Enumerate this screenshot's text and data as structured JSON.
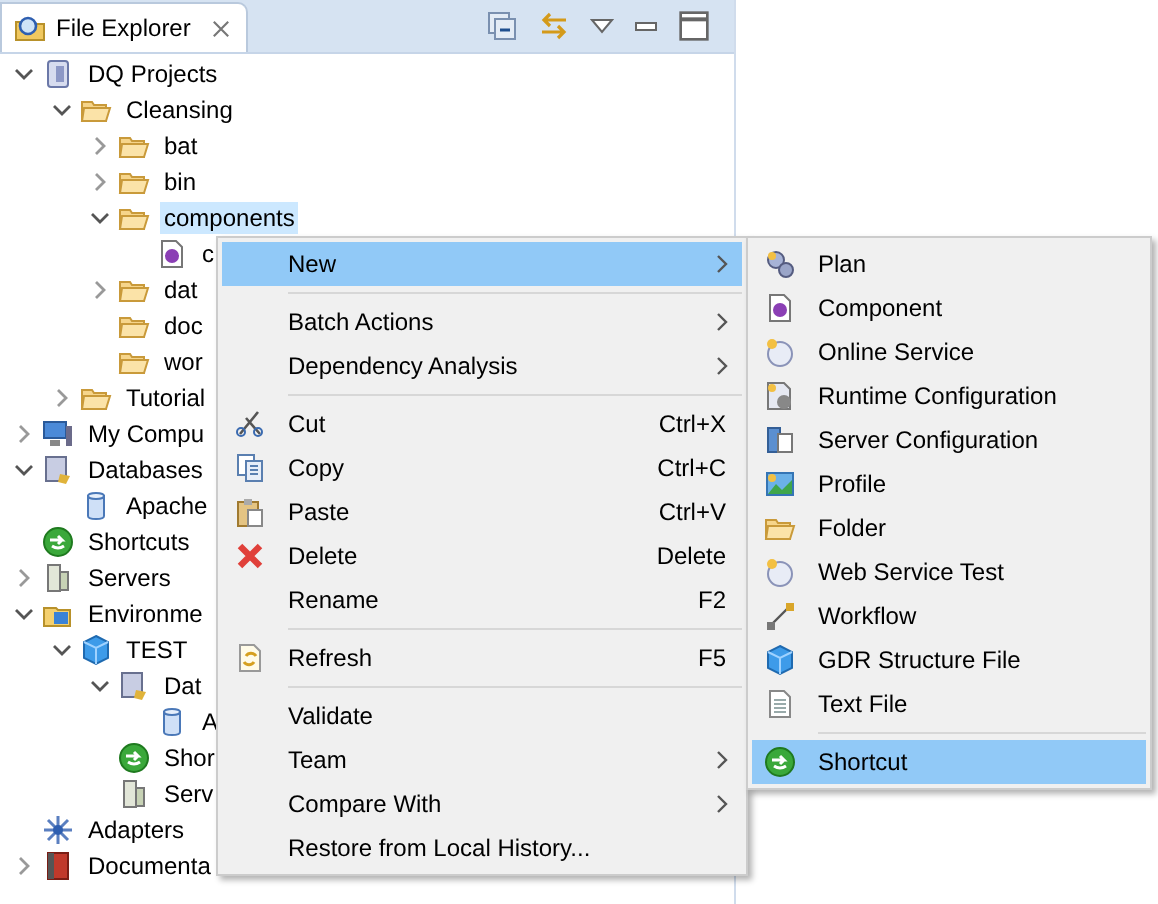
{
  "view": {
    "tab": {
      "title": "File Explorer",
      "selected": true
    }
  },
  "tree": [
    {
      "label": "DQ Projects",
      "kind": "project",
      "expanded": true,
      "selected": false,
      "children": [
        {
          "label": "Cleansing",
          "kind": "folder",
          "expanded": true,
          "selected": false,
          "children": [
            {
              "label": "bat",
              "kind": "folder",
              "expanded": false,
              "selected": false
            },
            {
              "label": "bin",
              "kind": "folder",
              "expanded": false,
              "selected": false
            },
            {
              "label": "components",
              "kind": "folder",
              "expanded": true,
              "selected": true,
              "children": [
                {
                  "label": "c",
                  "kind": "component",
                  "selected": false
                }
              ]
            },
            {
              "label": "dat",
              "kind": "folder",
              "expanded": false,
              "selected": false
            },
            {
              "label": "doc",
              "kind": "folder",
              "selected": false
            },
            {
              "label": "wor",
              "kind": "folder",
              "selected": false
            }
          ]
        },
        {
          "label": "Tutorial",
          "kind": "folder",
          "expanded": false,
          "selected": false
        }
      ]
    },
    {
      "label": "My Compu",
      "kind": "computer",
      "expanded": false,
      "selected": false
    },
    {
      "label": "Databases",
      "kind": "databases",
      "expanded": true,
      "selected": false,
      "children": [
        {
          "label": "Apache",
          "kind": "database",
          "selected": false
        }
      ]
    },
    {
      "label": "Shortcuts",
      "kind": "shortcut",
      "selected": false
    },
    {
      "label": "Servers",
      "kind": "servers",
      "expanded": false,
      "selected": false
    },
    {
      "label": "Environme",
      "kind": "environments",
      "expanded": true,
      "selected": false,
      "children": [
        {
          "label": "TEST",
          "kind": "cube",
          "expanded": true,
          "selected": false,
          "children": [
            {
              "label": "Dat",
              "kind": "databases",
              "expanded": true,
              "selected": false,
              "children": [
                {
                  "label": "A",
                  "kind": "database",
                  "selected": false
                }
              ]
            },
            {
              "label": "Shor",
              "kind": "shortcut",
              "selected": false
            },
            {
              "label": "Serv",
              "kind": "servers",
              "selected": false
            }
          ]
        }
      ]
    },
    {
      "label": "Adapters",
      "kind": "adapters",
      "selected": false
    },
    {
      "label": "Documenta",
      "kind": "docs",
      "expanded": false,
      "selected": false
    }
  ],
  "context_menu": {
    "groups": [
      [
        {
          "label": "New",
          "submenu": true,
          "selected": true
        }
      ],
      [
        {
          "label": "Batch Actions",
          "submenu": true,
          "selected": false
        },
        {
          "label": "Dependency Analysis",
          "submenu": true,
          "selected": false
        }
      ],
      [
        {
          "label": "Cut",
          "shortcut": "Ctrl+X",
          "kind": "cut",
          "selected": false
        },
        {
          "label": "Copy",
          "shortcut": "Ctrl+C",
          "kind": "copy",
          "selected": false
        },
        {
          "label": "Paste",
          "shortcut": "Ctrl+V",
          "kind": "paste",
          "selected": false
        },
        {
          "label": "Delete",
          "shortcut": "Delete",
          "kind": "delete",
          "selected": false
        },
        {
          "label": "Rename",
          "shortcut": "F2",
          "selected": false
        }
      ],
      [
        {
          "label": "Refresh",
          "shortcut": "F5",
          "kind": "refresh",
          "selected": false
        }
      ],
      [
        {
          "label": "Validate",
          "selected": false
        },
        {
          "label": "Team",
          "submenu": true,
          "selected": false
        },
        {
          "label": "Compare With",
          "submenu": true,
          "selected": false
        },
        {
          "label": "Restore from Local History...",
          "selected": false
        }
      ]
    ]
  },
  "new_submenu": {
    "groups": [
      [
        {
          "label": "Plan",
          "kind": "plan",
          "selected": false
        },
        {
          "label": "Component",
          "kind": "component",
          "selected": false
        },
        {
          "label": "Online Service",
          "kind": "service",
          "selected": false
        },
        {
          "label": "Runtime Configuration",
          "kind": "runtime",
          "selected": false
        },
        {
          "label": "Server Configuration",
          "kind": "servercfg",
          "selected": false
        },
        {
          "label": "Profile",
          "kind": "profile",
          "selected": false
        },
        {
          "label": "Folder",
          "kind": "folder",
          "selected": false
        },
        {
          "label": "Web Service Test",
          "kind": "service",
          "selected": false
        },
        {
          "label": "Workflow",
          "kind": "workflow",
          "selected": false
        },
        {
          "label": "GDR Structure File",
          "kind": "cube",
          "selected": false
        },
        {
          "label": "Text File",
          "kind": "text",
          "selected": false
        }
      ],
      [
        {
          "label": "Shortcut",
          "kind": "shortcut",
          "selected": true
        }
      ]
    ]
  }
}
